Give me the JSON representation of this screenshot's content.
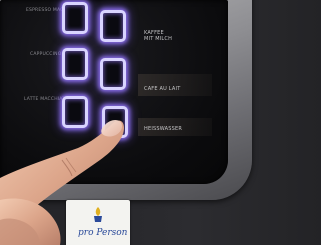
{
  "panel": {
    "labels_left": [
      "Espresso Macchiato",
      "Cappuccino",
      "Latte Macchiato"
    ],
    "labels_right": [
      "Kaffee mit Milch",
      "Cafe au lait",
      "Heisswasser"
    ]
  },
  "sticker": {
    "text": "pro Person"
  }
}
